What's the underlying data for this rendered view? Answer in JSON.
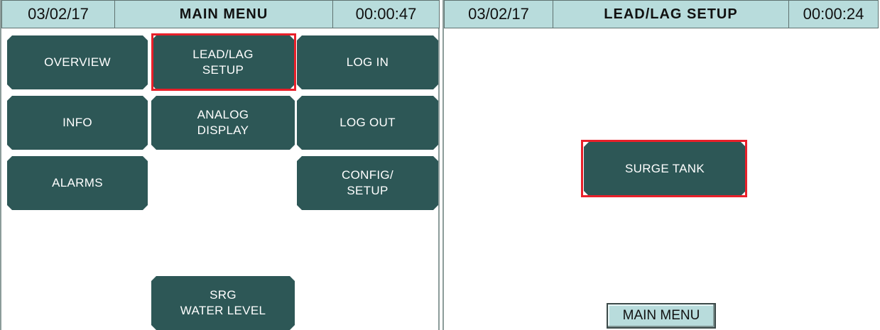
{
  "colors": {
    "bg": "#ffffff",
    "header_bg": "#b8dcdc",
    "button_bg": "#2d5756",
    "button_text": "#ffffff",
    "highlight": "#e8202a"
  },
  "left_screen": {
    "header": {
      "date": "03/02/17",
      "title": "MAIN MENU",
      "time": "00:00:47"
    },
    "buttons": {
      "overview": "OVERVIEW",
      "lead_lag_setup": "LEAD/LAG\nSETUP",
      "log_in": "LOG IN",
      "info": "INFO",
      "analog_display": "ANALOG\nDISPLAY",
      "log_out": "LOG OUT",
      "alarms": "ALARMS",
      "config_setup": "CONFIG/\nSETUP",
      "srg_water_level": "SRG\nWATER LEVEL"
    }
  },
  "right_screen": {
    "header": {
      "date": "03/02/17",
      "title": "LEAD/LAG SETUP",
      "time": "00:00:24"
    },
    "buttons": {
      "surge_tank": "SURGE TANK",
      "main_menu": "MAIN MENU"
    }
  }
}
